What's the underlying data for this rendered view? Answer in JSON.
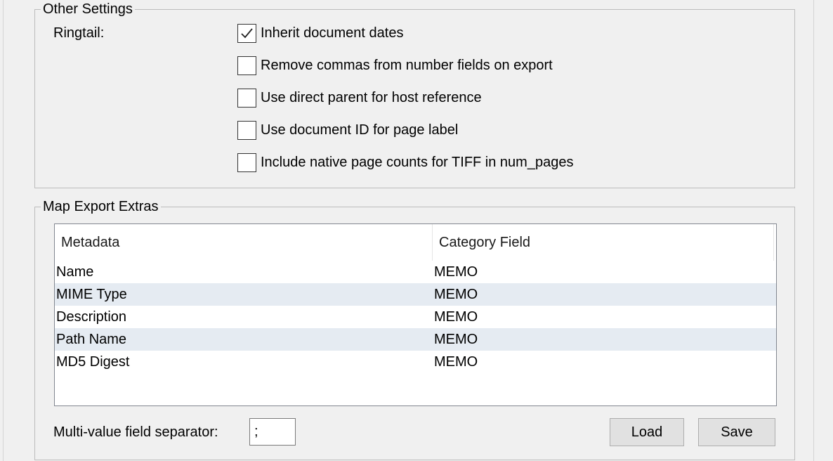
{
  "other_settings": {
    "legend": "Other Settings",
    "ringtail_label": "Ringtail:",
    "options": [
      {
        "label": "Inherit document dates",
        "checked": true
      },
      {
        "label": "Remove commas from number fields on export",
        "checked": false
      },
      {
        "label": "Use direct parent for host reference",
        "checked": false
      },
      {
        "label": "Use document ID for page label",
        "checked": false
      },
      {
        "label": "Include native page counts for TIFF in num_pages",
        "checked": false
      }
    ]
  },
  "map_export": {
    "legend": "Map Export Extras",
    "columns": [
      "Metadata",
      "Category Field"
    ],
    "rows": [
      [
        "Name",
        "MEMO"
      ],
      [
        "MIME Type",
        "MEMO"
      ],
      [
        "Description",
        "MEMO"
      ],
      [
        "Path Name",
        "MEMO"
      ],
      [
        "MD5 Digest",
        "MEMO"
      ]
    ],
    "separator_label": "Multi-value field separator:",
    "separator_value": ";",
    "load_label": "Load",
    "save_label": "Save"
  }
}
